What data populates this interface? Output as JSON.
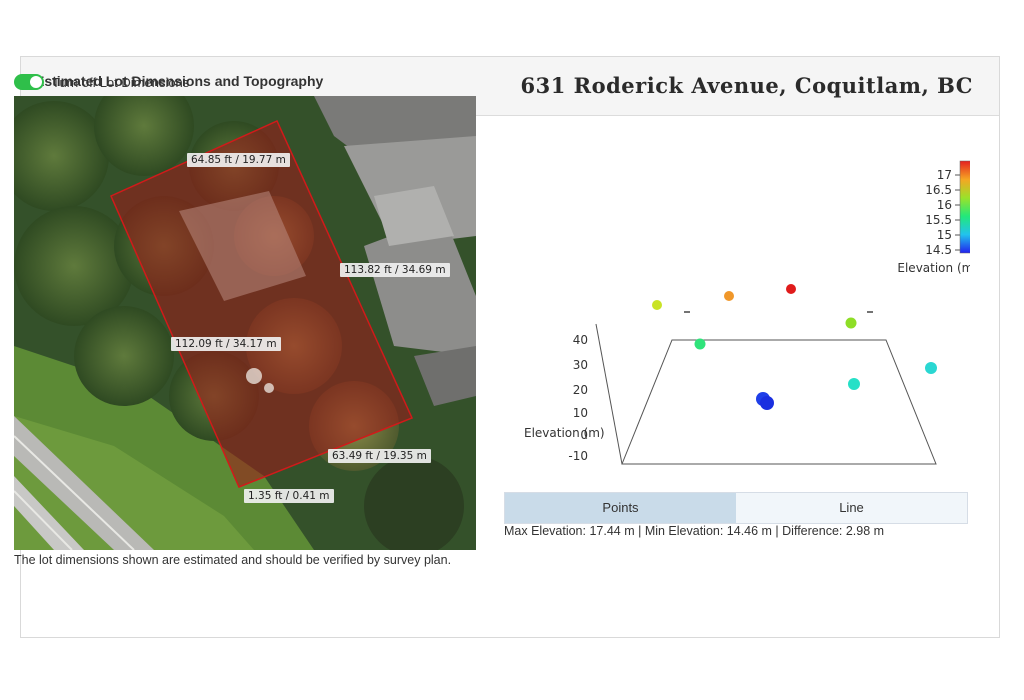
{
  "panel": {
    "title": "Estimated Lot Dimensions and Topography",
    "address": "631 Roderick Avenue, Coquitlam, BC"
  },
  "toggle": {
    "label": "Turn off Lot Dimensions",
    "state": "on",
    "color": "#2fbf4a"
  },
  "map": {
    "dimension_labels": [
      "64.85 ft / 19.77 m",
      "113.82 ft / 34.69 m",
      "112.09 ft / 34.17 m",
      "63.49 ft / 19.35 m",
      "1.35 ft / 0.41 m"
    ],
    "lot_outline_color": "#d11a1a",
    "lot_fill_color": "#a01818"
  },
  "disclaimer": "The lot dimensions shown are estimated and should be verified by survey plan.",
  "chart_data": {
    "type": "scatter",
    "z_axis_label": "Elevation (m)",
    "z_ticks": [
      "40",
      "30",
      "20",
      "10",
      "0",
      "-10"
    ],
    "colorbar": {
      "title": "Elevation (m)",
      "ticks": [
        "17",
        "16.5",
        "16",
        "15.5",
        "15",
        "14.5"
      ],
      "range": [
        14.46,
        17.44
      ],
      "colorscale": [
        "#2222ee",
        "#22c3ee",
        "#22e87a",
        "#9be22a",
        "#f5a623",
        "#e52121"
      ]
    },
    "points": [
      {
        "elevation": 16.5,
        "color": "#c9e326"
      },
      {
        "elevation": 17.0,
        "color": "#f0972a"
      },
      {
        "elevation": 17.44,
        "color": "#e01b1b"
      },
      {
        "elevation": 16.3,
        "color": "#8ede26"
      },
      {
        "elevation": 15.8,
        "color": "#2fe37a"
      },
      {
        "elevation": 15.4,
        "color": "#26e0c7"
      },
      {
        "elevation": 15.4,
        "color": "#2ad7d2"
      },
      {
        "elevation": 14.5,
        "color": "#1f3fe8"
      },
      {
        "elevation": 14.46,
        "color": "#1a2fe0"
      }
    ]
  },
  "tabs": [
    {
      "label": "Points",
      "active": true
    },
    {
      "label": "Line",
      "active": false
    }
  ],
  "stats": "Max Elevation: 17.44 m | Min Elevation: 14.46 m | Difference: 2.98 m"
}
